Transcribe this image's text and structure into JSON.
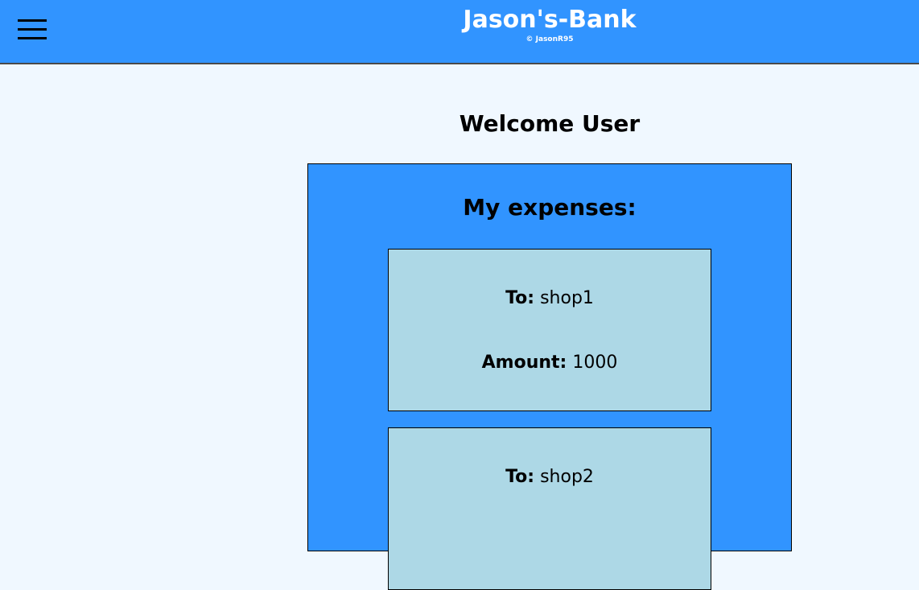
{
  "header": {
    "menu_icon": "hamburger-menu-icon",
    "title": "Jason's-Bank",
    "copyright": "© JasonR95",
    "background_color": "#3194ff"
  },
  "main": {
    "welcome": "Welcome User",
    "expenses_title": "My expenses:",
    "panel_color": "#3194ff",
    "card_color": "#add8e6",
    "to_label": "To:",
    "amount_label": "Amount:",
    "expenses": [
      {
        "to": "shop1",
        "amount": "1000"
      },
      {
        "to": "shop2",
        "amount": ""
      }
    ]
  }
}
